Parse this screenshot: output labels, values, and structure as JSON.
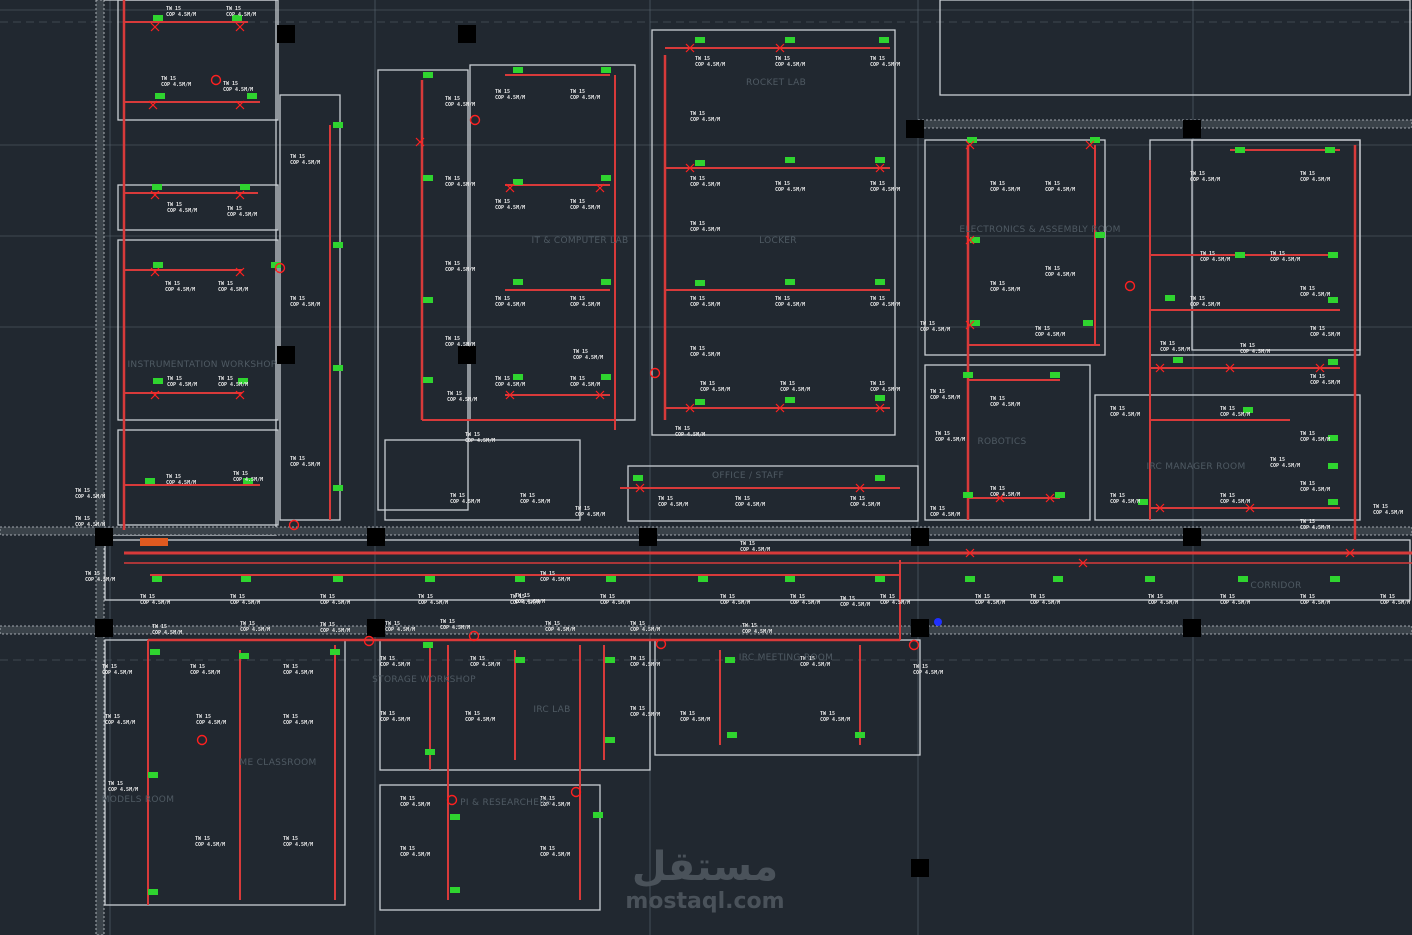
{
  "drawing": {
    "rooms": [
      {
        "id": "rocket-lab",
        "label": "ROCKET LAB"
      },
      {
        "id": "it-lab",
        "label": "IT & COMPUTER LAB"
      },
      {
        "id": "locker",
        "label": "LOCKER"
      },
      {
        "id": "electronics",
        "label": "ELECTRONICS & ASSEMBLY ROOM"
      },
      {
        "id": "instrumentation",
        "label": "INSTRUMENTATION WORKSHOP"
      },
      {
        "id": "robotics",
        "label": "ROBOTICS"
      },
      {
        "id": "irc-manager",
        "label": "IRC MANAGER ROOM"
      },
      {
        "id": "office",
        "label": "OFFICE / STAFF"
      },
      {
        "id": "corridor",
        "label": "CORRIDOR"
      },
      {
        "id": "me-classroom",
        "label": "ME CLASSROOM"
      },
      {
        "id": "models-room",
        "label": "MODELS ROOM"
      },
      {
        "id": "storage",
        "label": "STORAGE WORKSHOP"
      },
      {
        "id": "irc-lab",
        "label": "IRC LAB"
      },
      {
        "id": "pi-research",
        "label": "PI & RESEARCHERS"
      },
      {
        "id": "meeting-room",
        "label": "IRC MEETING ROOM"
      }
    ],
    "tag_lines": {
      "top": "TW 15",
      "bottom": "COP 4.5M/M"
    },
    "watermark": {
      "arabic": "مستقل",
      "latin": "mostaql.com"
    },
    "colors": {
      "background": "#212830",
      "wall": "#c9ced3",
      "pipe": "#d83a3a",
      "device": "#2fd42f",
      "marker": "#ff2020",
      "column": "#000000",
      "grid": "#5d6872"
    }
  }
}
